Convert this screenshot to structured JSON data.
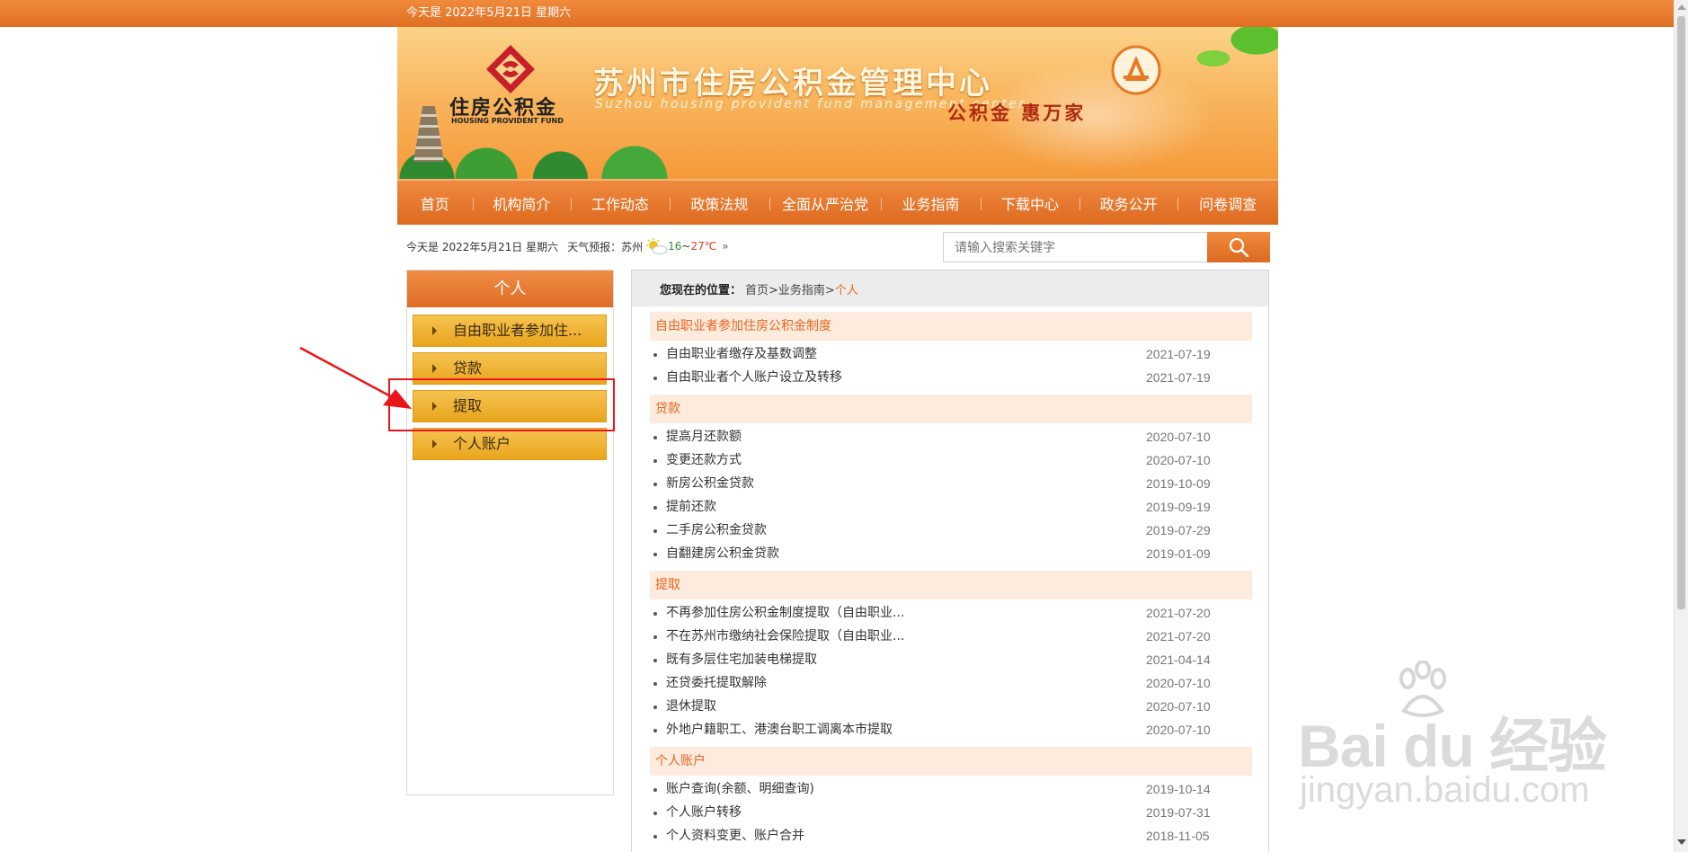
{
  "topbar": {
    "date_text": "今天是 2022年5月21日  星期六"
  },
  "banner": {
    "title": "苏州市住房公积金管理中心",
    "subtitle": "Suzhou housing provident fund management center",
    "logo_cn": "住房公积金",
    "logo_en": "HOUSING PROVIDENT FUND",
    "slogan": "公积金 惠万家",
    "colors": {
      "logo_red": "#c8202a",
      "slogan_red": "#b02a10"
    }
  },
  "nav": {
    "items": [
      {
        "label": "首页"
      },
      {
        "label": "机构简介"
      },
      {
        "label": "工作动态"
      },
      {
        "label": "政策法规"
      },
      {
        "label": "全面从严治党"
      },
      {
        "label": "业务指南"
      },
      {
        "label": "下载中心"
      },
      {
        "label": "政务公开"
      },
      {
        "label": "问卷调查"
      }
    ]
  },
  "infobar": {
    "date": "今天是 2022年5月21日  星期六",
    "weather_label": "天气预报：",
    "city": "苏州",
    "weather_icon": "sun-cloud-icon",
    "temp_low": "16",
    "temp_sep": "~",
    "temp_high": "27℃",
    "more": "»"
  },
  "search": {
    "placeholder": "请输入搜索关键字",
    "icon": "search-icon"
  },
  "sidebar": {
    "title": "个人",
    "items": [
      {
        "label": "自由职业者参加住..."
      },
      {
        "label": "贷款"
      },
      {
        "label": "提取"
      },
      {
        "label": "个人账户"
      }
    ]
  },
  "breadcrumb": {
    "label": "您现在的位置：",
    "path": "首页>业务指南>",
    "current": "个人"
  },
  "sections": [
    {
      "title": "自由职业者参加住房公积金制度",
      "items": [
        {
          "title": "自由职业者缴存及基数调整",
          "date": "2021-07-19"
        },
        {
          "title": "自由职业者个人账户设立及转移",
          "date": "2021-07-19"
        }
      ]
    },
    {
      "title": "贷款",
      "items": [
        {
          "title": "提高月还款额",
          "date": "2020-07-10"
        },
        {
          "title": "变更还款方式",
          "date": "2020-07-10"
        },
        {
          "title": "新房公积金贷款",
          "date": "2019-10-09"
        },
        {
          "title": "提前还款",
          "date": "2019-09-19"
        },
        {
          "title": "二手房公积金贷款",
          "date": "2019-07-29"
        },
        {
          "title": "自翻建房公积金贷款",
          "date": "2019-01-09"
        }
      ]
    },
    {
      "title": "提取",
      "items": [
        {
          "title": "不再参加住房公积金制度提取（自由职业...",
          "date": "2021-07-20"
        },
        {
          "title": "不在苏州市缴纳社会保险提取（自由职业...",
          "date": "2021-07-20"
        },
        {
          "title": "既有多层住宅加装电梯提取",
          "date": "2021-04-14"
        },
        {
          "title": "还贷委托提取解除",
          "date": "2020-07-10"
        },
        {
          "title": "退休提取",
          "date": "2020-07-10"
        },
        {
          "title": "外地户籍职工、港澳台职工调离本市提取",
          "date": "2020-07-10"
        }
      ]
    },
    {
      "title": "个人账户",
      "items": [
        {
          "title": "账户查询(余额、明细查询)",
          "date": "2019-10-14"
        },
        {
          "title": "个人账户转移",
          "date": "2019-07-31"
        },
        {
          "title": "个人资料变更、账户合并",
          "date": "2018-11-05"
        }
      ]
    }
  ],
  "watermark": {
    "brand": "Bai du 经验",
    "url": "jingyan.baidu.com"
  },
  "annotation": {
    "color": "#e8161a"
  }
}
